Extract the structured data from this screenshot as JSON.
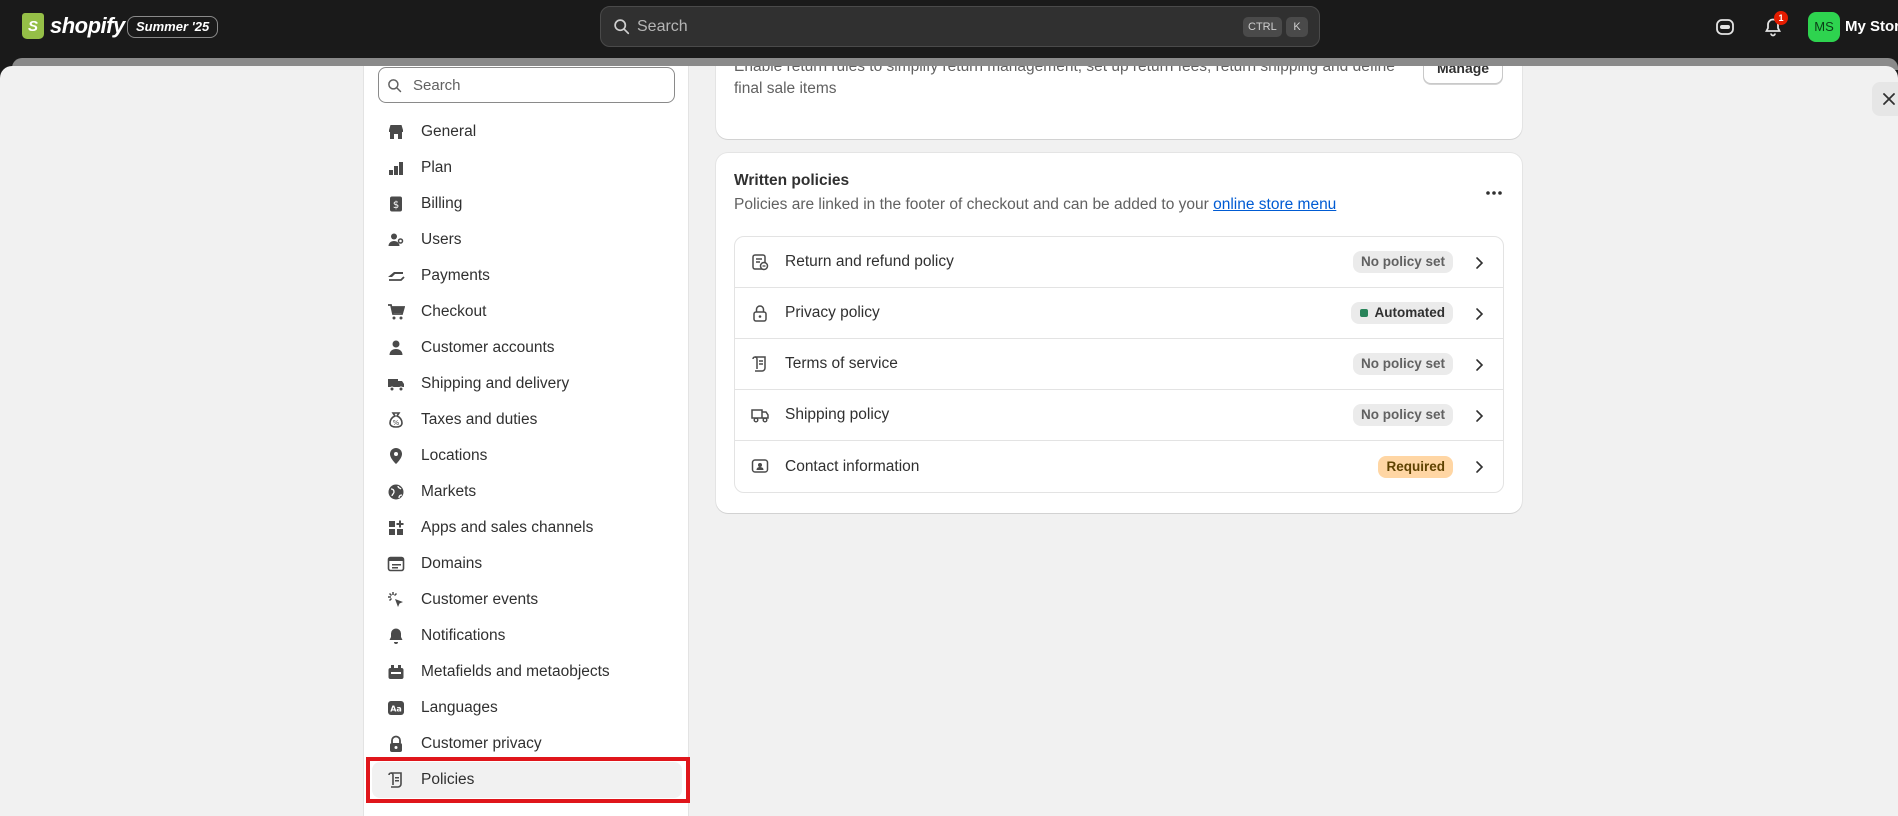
{
  "topbar": {
    "brand": "shopify",
    "edition": "Summer '25",
    "search_placeholder": "Search",
    "shortcut_ctrl": "CTRL",
    "shortcut_key": "K",
    "notification_count": "1",
    "avatar_initials": "MS",
    "store_name": "My Store"
  },
  "sidebar": {
    "search_placeholder": "Search",
    "items": [
      {
        "label": "General",
        "icon": "store-icon"
      },
      {
        "label": "Plan",
        "icon": "plan-icon"
      },
      {
        "label": "Billing",
        "icon": "billing-icon"
      },
      {
        "label": "Users",
        "icon": "users-icon"
      },
      {
        "label": "Payments",
        "icon": "payments-icon"
      },
      {
        "label": "Checkout",
        "icon": "cart-icon"
      },
      {
        "label": "Customer accounts",
        "icon": "person-icon"
      },
      {
        "label": "Shipping and delivery",
        "icon": "truck-icon"
      },
      {
        "label": "Taxes and duties",
        "icon": "tax-icon"
      },
      {
        "label": "Locations",
        "icon": "location-pin-icon"
      },
      {
        "label": "Markets",
        "icon": "globe-icon"
      },
      {
        "label": "Apps and sales channels",
        "icon": "apps-icon"
      },
      {
        "label": "Domains",
        "icon": "domain-icon"
      },
      {
        "label": "Customer events",
        "icon": "cursor-click-icon"
      },
      {
        "label": "Notifications",
        "icon": "bell-icon"
      },
      {
        "label": "Metafields and metaobjects",
        "icon": "metafields-icon"
      },
      {
        "label": "Languages",
        "icon": "language-icon"
      },
      {
        "label": "Customer privacy",
        "icon": "lock-icon"
      },
      {
        "label": "Policies",
        "icon": "policy-icon"
      }
    ]
  },
  "return_rules": {
    "description": "Enable return rules to simplify return management, set up return fees, return shipping and define final sale items",
    "manage_label": "Manage"
  },
  "written_policies": {
    "title": "Written policies",
    "subtitle": "Policies are linked in the footer of checkout and can be added to your ",
    "link_text": "online store menu",
    "rows": [
      {
        "label": "Return and refund policy",
        "badge": "No policy set"
      },
      {
        "label": "Privacy policy",
        "badge": "Automated"
      },
      {
        "label": "Terms of service",
        "badge": "No policy set"
      },
      {
        "label": "Shipping policy",
        "badge": "No policy set"
      },
      {
        "label": "Contact information",
        "badge": "Required"
      }
    ]
  },
  "colors": {
    "topbar_bg": "#1a1a1a",
    "highlight": "#e0161b",
    "link": "#005bd3",
    "required_badge": "#ffd6a4",
    "automated_dot": "#29845a"
  }
}
